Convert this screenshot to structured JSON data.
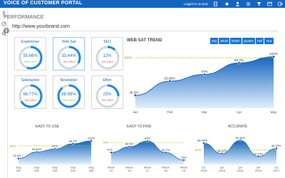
{
  "app": {
    "title": "VOICE OF CUSTOMER PORTAL",
    "login": "Logged in as QaQ"
  },
  "page": {
    "title": "PERFORMANCE",
    "url": "http://www.yourbrand.com"
  },
  "colors": {
    "accent": "#1976d2",
    "positive": "#8ab833",
    "negative": "#e53935",
    "target": "#9ccc00"
  },
  "kpis": [
    {
      "label": "Experience",
      "value": "55.66%",
      "delta": "+3% VSLY",
      "trend": "positive",
      "fill": 0.5566
    },
    {
      "label": "Web Sat",
      "value": "33.44%",
      "delta": "-3% VSLY",
      "trend": "negative",
      "fill": 0.3344,
      "selected": true
    },
    {
      "label": "SEO",
      "value": "12%",
      "delta": "-4% VSLY",
      "trend": "negative",
      "fill": 0.12
    },
    {
      "label": "Satisfaction",
      "value": "66.77%",
      "delta": "-4% VSLY",
      "trend": "negative",
      "fill": 0.6677
    },
    {
      "label": "Resolution",
      "value": "88.99%",
      "delta": "+5% VSLY",
      "trend": "positive",
      "fill": 0.8899
    },
    {
      "label": "Effort",
      "value": "25%",
      "delta": "-4% VSLY",
      "trend": "negative",
      "fill": 0.25
    }
  ],
  "web_sat_trend": {
    "title": "WEB SAT TREND",
    "ranges": [
      "Day",
      "Week",
      "Month",
      "Quarter",
      "Half",
      "Year"
    ]
  },
  "chart_data": [
    {
      "type": "area",
      "title": "",
      "x": [
        "Jan",
        "Feb",
        "Mar",
        "Apr",
        "May"
      ],
      "values": [
        25.5,
        53.66,
        67,
        89.7,
        102
      ],
      "labels": [
        "25.5%",
        "53.66%",
        "67%",
        "89.7%",
        "102%"
      ],
      "target": 100,
      "target_label": "100%",
      "ylim": [
        0,
        110
      ]
    },
    {
      "type": "area",
      "title": "EASY TO USE",
      "x": [
        "Day 251",
        "Day 252",
        "Day 253",
        "Day 254",
        "Day 255"
      ],
      "values": [
        25.9,
        53.66,
        67,
        89.7,
        102
      ],
      "labels": [
        "25.9%",
        "53.66%",
        "67%",
        "89.7%",
        "102%"
      ],
      "target": 80,
      "target_label": "80%",
      "ylim": [
        0,
        120
      ]
    },
    {
      "type": "area",
      "title": "EASY TO FIND",
      "x": [
        "Week 15",
        "Week 16",
        "Week 17",
        "Week 18",
        "Week 19"
      ],
      "values": [
        41,
        60.5,
        80,
        40.7,
        15
      ],
      "labels": [
        "41%",
        "60.5%",
        "80%",
        "40.7%",
        "15%"
      ],
      "target": 75,
      "target_label": "75%",
      "ylim": [
        0,
        95
      ]
    },
    {
      "type": "area",
      "title": "ACCURATE",
      "x": [
        "Q1 2016",
        "Q2 2016",
        "Q3 2016",
        "Q4 2016",
        "Q1 2017"
      ],
      "values": [
        88.44,
        44.32,
        99.48,
        33.15,
        66.33
      ],
      "labels": [
        "88.44%",
        "44.32%",
        "99.48%",
        "33.15%",
        "66.33%"
      ],
      "target": 60,
      "target_label": "60%",
      "ylim": [
        0,
        115
      ]
    }
  ]
}
